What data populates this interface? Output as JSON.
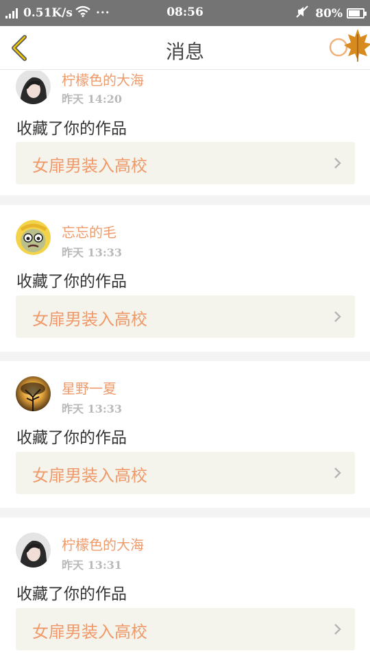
{
  "status_bar": {
    "network_speed": "0.51K/s",
    "dots": "···",
    "time": "08:56",
    "battery": "80%",
    "battery_level": 0.8
  },
  "header": {
    "title": "消息",
    "accent_color": "#ef9a6a"
  },
  "messages": [
    {
      "username": "柠檬色的大海",
      "time": "昨天 14:20",
      "action": "收藏了你的作品",
      "work_title": "女扉男装入高校"
    },
    {
      "username": "忘忘的毛",
      "time": "昨天 13:33",
      "action": "收藏了你的作品",
      "work_title": "女扉男装入高校"
    },
    {
      "username": "星野一夏",
      "time": "昨天 13:33",
      "action": "收藏了你的作品",
      "work_title": "女扉男装入高校"
    },
    {
      "username": "柠檬色的大海",
      "time": "昨天 13:31",
      "action": "收藏了你的作品",
      "work_title": "女扉男装入高校"
    }
  ]
}
